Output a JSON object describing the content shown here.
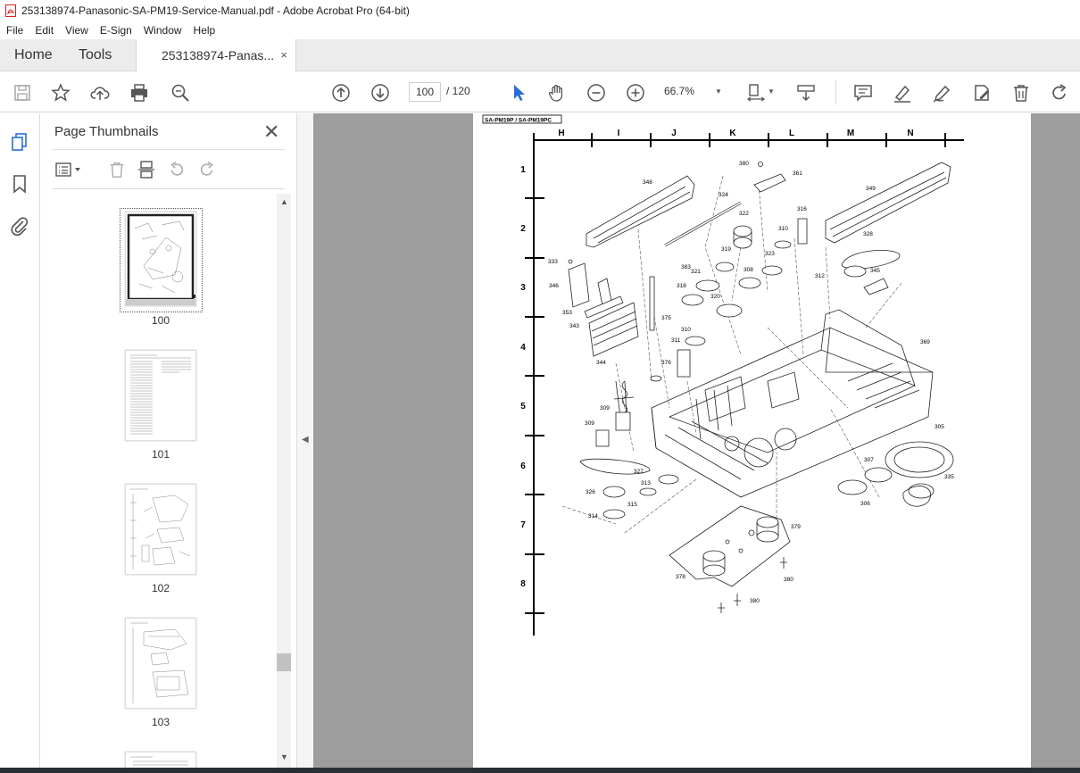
{
  "window": {
    "title": "253138974-Panasonic-SA-PM19-Service-Manual.pdf - Adobe Acrobat Pro (64-bit)"
  },
  "menu": [
    "File",
    "Edit",
    "View",
    "E-Sign",
    "Window",
    "Help"
  ],
  "tabs": {
    "home": "Home",
    "tools": "Tools",
    "document": "253138974-Panas...",
    "close": "×"
  },
  "toolbar": {
    "page_current": "100",
    "page_total": "/ 120",
    "zoom": "66.7%"
  },
  "panel": {
    "title": "Page Thumbnails",
    "close": "✕"
  },
  "thumbnails": [
    {
      "label": "100"
    },
    {
      "label": "101"
    },
    {
      "label": "102"
    },
    {
      "label": "103"
    }
  ],
  "document": {
    "header_tag": "SA-PM19P / SA-PM19PC",
    "columns": [
      "H",
      "I",
      "J",
      "K",
      "L",
      "M",
      "N"
    ],
    "rows": [
      "1",
      "2",
      "3",
      "4",
      "5",
      "6",
      "7",
      "8"
    ],
    "parts": [
      "380",
      "361",
      "348",
      "324",
      "349",
      "322",
      "316",
      "310",
      "328",
      "319",
      "323",
      "333",
      "383",
      "321",
      "308",
      "312",
      "345",
      "346",
      "318",
      "320",
      "353",
      "375",
      "343",
      "310",
      "311",
      "369",
      "344",
      "376",
      "309",
      "309",
      "305",
      "327",
      "307",
      "313",
      "326",
      "306",
      "335",
      "315",
      "314",
      "379",
      "378",
      "380",
      "380"
    ]
  }
}
